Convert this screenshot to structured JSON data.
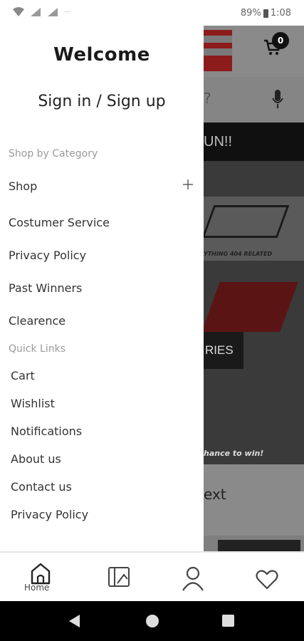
{
  "status_bar": {
    "battery": "89%",
    "time": "1:08",
    "more": "···"
  },
  "background": {
    "cart_count": "0",
    "search_hint": "?",
    "banner_text": "UN!!",
    "hero_tagline": "YTHING 404 RELATED",
    "hero_category": "RIES",
    "hero_footer": "hance to win!",
    "next_text": "ext"
  },
  "drawer": {
    "welcome": "Welcome",
    "signin": "Sign in / Sign up",
    "shop_by_category": "Shop by Category",
    "categories": [
      "Shop",
      "Costumer Service",
      "Privacy Policy",
      "Past Winners",
      "Clearence"
    ],
    "quick_links_title": "Quick Links",
    "quick_links": [
      "Cart",
      "Wishlist",
      "Notifications",
      "About us",
      "Contact us",
      "Privacy Policy"
    ]
  },
  "bottom_nav": {
    "home_label": "Home"
  },
  "icons": {
    "wifi": "wifi-icon",
    "cart": "cart-icon",
    "mic": "mic-icon",
    "plus": "plus-icon",
    "home": "home-icon",
    "catalog": "catalog-icon",
    "account": "person-icon",
    "wishlist": "heart-icon"
  }
}
